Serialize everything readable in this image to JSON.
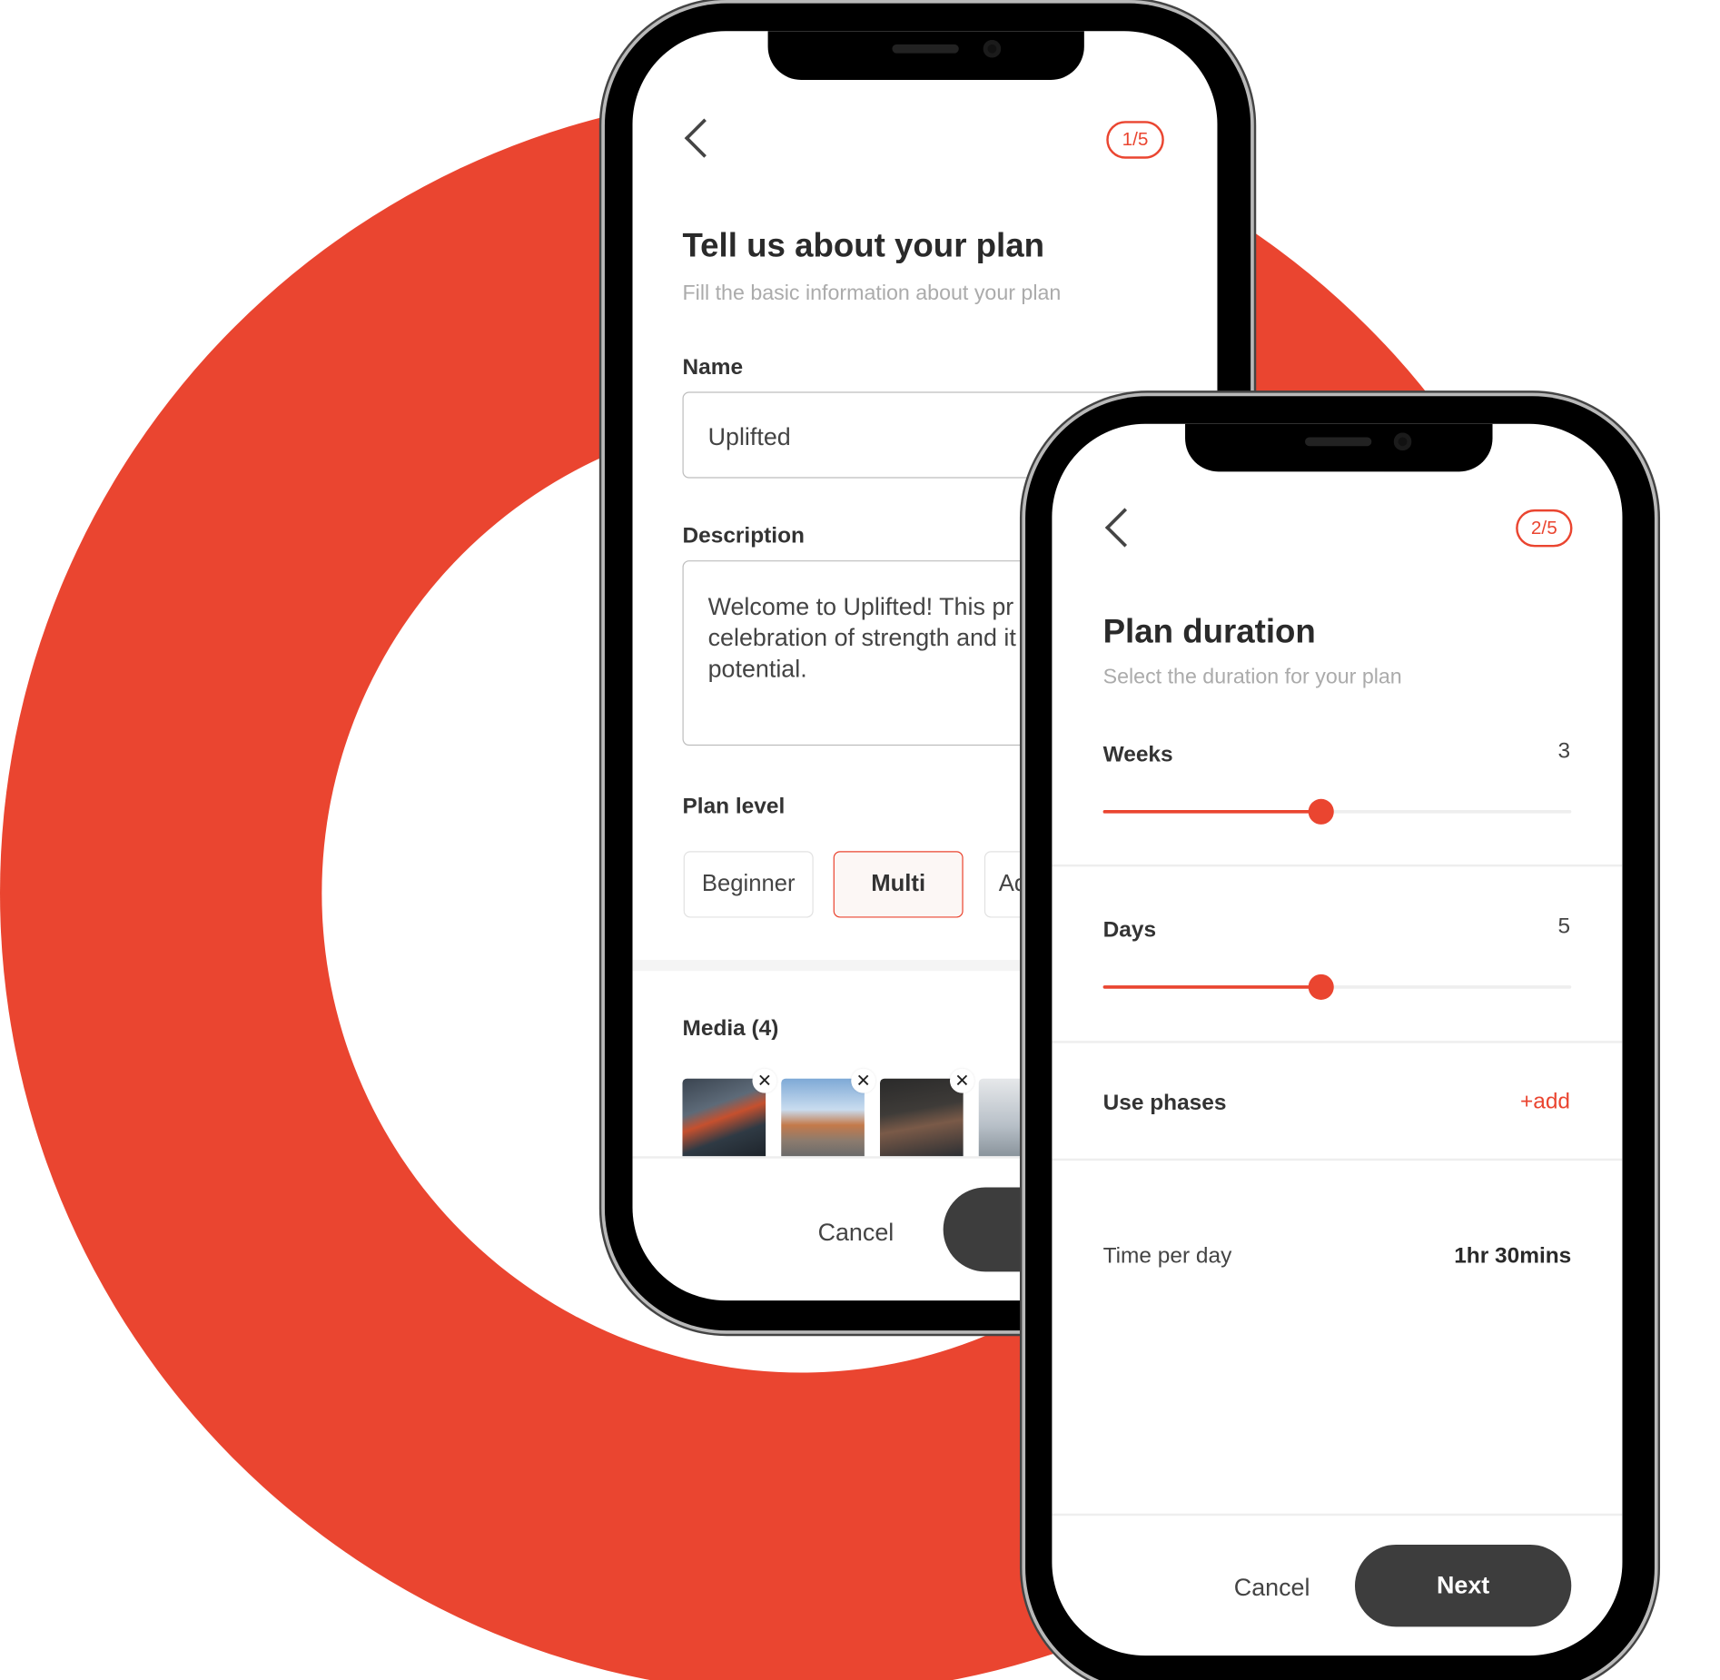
{
  "colors": {
    "accent": "#EA4530",
    "dark_button": "#3d3d3d",
    "ring": "#EA4530"
  },
  "phone1": {
    "back_icon": "chevron-left-icon",
    "step": "1/5",
    "title": "Tell us about your plan",
    "subtitle": "Fill the basic information about your plan",
    "name_label": "Name",
    "name_value": "Uplifted",
    "description_label": "Description",
    "description_lines": [
      "Welcome to Uplifted! This pr",
      "celebration of strength and it",
      "potential."
    ],
    "plan_level_label": "Plan level",
    "plan_levels": [
      {
        "label": "Beginner",
        "selected": false
      },
      {
        "label": "Multi",
        "selected": true
      },
      {
        "label": "Advanced",
        "selected": false
      }
    ],
    "media_label": "Media (4)",
    "media_remove_icon": "close-icon",
    "cancel_label": "Cancel"
  },
  "phone2": {
    "back_icon": "chevron-left-icon",
    "step": "2/5",
    "title": "Plan duration",
    "subtitle": "Select the duration for your plan",
    "weeks_label": "Weeks",
    "weeks_value": "3",
    "weeks_slider_fraction": 0.465,
    "days_label": "Days",
    "days_value": "5",
    "days_slider_fraction": 0.465,
    "phases_label": "Use phases",
    "phases_add": "+add",
    "time_label": "Time per day",
    "time_value": "1hr 30mins",
    "cancel_label": "Cancel",
    "next_label": "Next"
  }
}
